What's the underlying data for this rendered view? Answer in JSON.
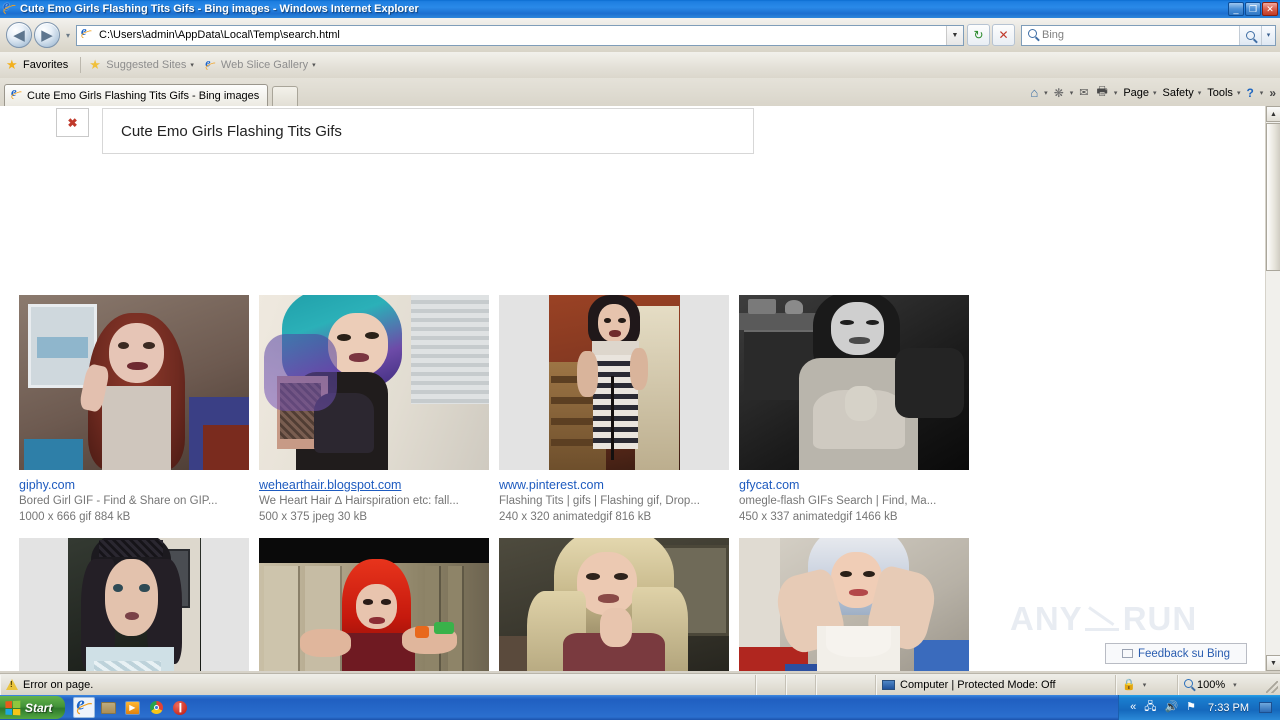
{
  "window": {
    "title": "Cute Emo Girls Flashing Tits Gifs - Bing images - Windows Internet Explorer",
    "icon": "ie-logo-icon",
    "minimize_label": "_",
    "maximize_label": "❐",
    "close_label": "✕"
  },
  "navbar": {
    "back_label": "◀",
    "forward_label": "▶",
    "history_caret": "▾",
    "address_value": "C:\\Users\\admin\\AppData\\Local\\Temp\\search.html",
    "address_caret": "▼",
    "refresh_label": "↻",
    "stop_label": "✕",
    "search_placeholder": "Bing",
    "search_dropdown": "▾"
  },
  "favorites_bar": {
    "favorites_label": "Favorites",
    "items": [
      {
        "label": "Suggested Sites",
        "caret": "▾"
      },
      {
        "label": "Web Slice Gallery",
        "caret": "▾"
      }
    ]
  },
  "tabs": [
    {
      "label": "Cute Emo Girls Flashing Tits Gifs - Bing images",
      "active": true
    }
  ],
  "command_bar": {
    "home": {
      "label": "",
      "icon": "home-icon",
      "caret": "▾"
    },
    "feeds": {
      "label": "",
      "icon": "rss-icon",
      "caret": "▾"
    },
    "mail": {
      "label": "",
      "icon": "mail-icon"
    },
    "print": {
      "label": "",
      "icon": "printer-icon",
      "caret": "▾"
    },
    "page": {
      "label": "Page",
      "caret": "▾"
    },
    "safety": {
      "label": "Safety",
      "caret": "▾"
    },
    "tools": {
      "label": "Tools",
      "caret": "▾"
    },
    "help": {
      "label": "",
      "icon": "help-icon",
      "caret": "▾"
    },
    "overflow": "»"
  },
  "page": {
    "broken_image_alt": "✖",
    "query_value": "Cute Emo Girls Flashing Tits Gifs",
    "watermark_left": "ANY",
    "watermark_right": "RUN",
    "feedback_label": "Feedback su Bing",
    "results": [
      {
        "site": "giphy.com",
        "underlined": false,
        "description": "Bored Girl GIF - Find & Share on GIP...",
        "meta": "1000 x 666 gif 884 kB",
        "thumb": "redhead-webcam-thumb"
      },
      {
        "site": "wehearthair.blogspot.com",
        "underlined": true,
        "description": "We Heart Hair ∆ Hairspiration etc: fall...",
        "meta": "500 x 375 jpeg 30 kB",
        "thumb": "teal-purple-hair-thumb"
      },
      {
        "site": "www.pinterest.com",
        "underlined": false,
        "description": "Flashing Tits | gifs | Flashing gif, Drop...",
        "meta": "240 x 320 animatedgif 816 kB",
        "thumb": "striped-dress-thumb"
      },
      {
        "site": "gfycat.com",
        "underlined": false,
        "description": "omegle-flash GIFs Search | Find, Ma...",
        "meta": "450 x 337 animatedgif 1466 kB",
        "thumb": "bw-portrait-thumb"
      },
      {
        "site": "",
        "underlined": false,
        "description": "",
        "meta": "",
        "thumb": "beanie-girl-thumb"
      },
      {
        "site": "",
        "underlined": false,
        "description": "",
        "meta": "",
        "thumb": "red-hair-lockers-thumb"
      },
      {
        "site": "",
        "underlined": false,
        "description": "",
        "meta": "",
        "thumb": "blonde-couch-thumb"
      },
      {
        "site": "",
        "underlined": false,
        "description": "",
        "meta": "",
        "thumb": "white-hair-thumb"
      }
    ]
  },
  "scrollbar": {
    "up": "▲",
    "down": "▼"
  },
  "statusbar": {
    "error_text": "Error on page.",
    "zone_text": "Computer | Protected Mode: Off",
    "zoom_text": "100%",
    "zoom_caret": "▾",
    "protect_caret": "▾"
  },
  "taskbar": {
    "start_label": "Start",
    "quick_launch": [
      {
        "name": "internet-explorer",
        "active": true
      },
      {
        "name": "explorer-folder",
        "active": false
      },
      {
        "name": "media-player",
        "active": false
      },
      {
        "name": "chrome",
        "active": false
      },
      {
        "name": "stop-app",
        "active": false
      }
    ],
    "tray": {
      "show_hidden": "«",
      "icons": [
        "network-icon",
        "volume-icon",
        "flag-icon"
      ],
      "clock": "7:33 PM"
    }
  },
  "colors": {
    "title_blue": "#1d7ee0",
    "link_blue": "#1e5bbf",
    "meta_gray": "#767676",
    "chrome_bg": "#d8d4c8",
    "thumb_bg": "#e3e3e3"
  }
}
